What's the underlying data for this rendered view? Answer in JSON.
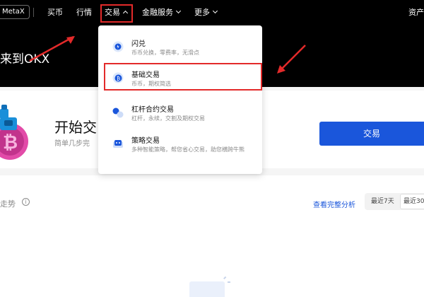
{
  "nav": {
    "brand": "MetaX",
    "items": [
      {
        "label": "买币"
      },
      {
        "label": "行情"
      },
      {
        "label": "交易"
      },
      {
        "label": "金融服务"
      },
      {
        "label": "更多"
      },
      {
        "label": "资产"
      }
    ]
  },
  "hero": {
    "title": "来到OKX"
  },
  "dropdown": {
    "items": [
      {
        "title": "闪兑",
        "desc": "币币兑换，零费率，无滑点",
        "icon": "swap-icon"
      },
      {
        "title": "基础交易",
        "desc": "币币，期权简选",
        "icon": "basic-trade-icon"
      },
      {
        "title": "杠杆合约交易",
        "desc": "杠杆，永续，交割及期权交易",
        "icon": "leverage-icon"
      },
      {
        "title": "策略交易",
        "desc": "多种智能策略，帮您省心交易，助您横跨牛熊",
        "icon": "bot-icon"
      }
    ]
  },
  "start_card": {
    "title": "开始交",
    "subtitle": "简单几步完",
    "trade_button": "交易"
  },
  "trend": {
    "title": "走势",
    "full_link": "查看完整分析",
    "range_options": [
      "最近7天",
      "最近30"
    ],
    "active_index": 1
  },
  "colors": {
    "accent": "#1a56db",
    "annotation_red": "#e32a2a",
    "nav_bg": "#000000"
  }
}
